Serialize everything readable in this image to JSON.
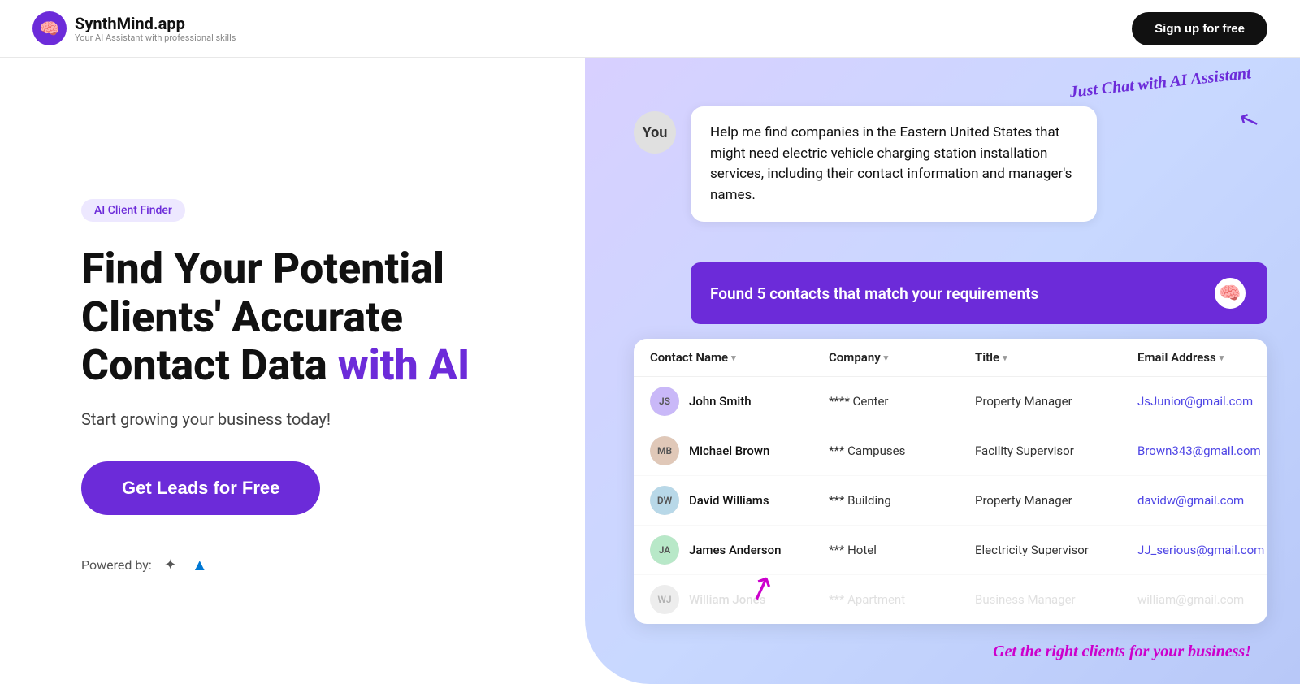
{
  "header": {
    "logo_title": "SynthMind.app",
    "logo_subtitle": "Your AI Assistant with professional skills",
    "logo_icon": "🧠",
    "signup_label": "Sign up for free"
  },
  "hero": {
    "badge": "AI Client Finder",
    "title_line1": "Find Your Potential",
    "title_line2": "Clients' Accurate",
    "title_line3_normal": "Contact Data ",
    "title_line3_highlight": "with AI",
    "subtitle": "Start growing your business today!",
    "cta_label": "Get Leads for Free",
    "powered_by_label": "Powered by:"
  },
  "chat": {
    "just_chat_label": "Just Chat with AI Assistant",
    "you_label": "You",
    "message": "Help me find companies in the Eastern United States that might need electric vehicle charging station installation services, including their contact information and manager's names.",
    "found_label": "Found 5 contacts that match your requirements",
    "get_clients_label": "Get the right clients for your business!"
  },
  "table": {
    "columns": [
      "Contact Name",
      "Company",
      "Title",
      "Email Address"
    ],
    "rows": [
      {
        "name": "John Smith",
        "company": "**** Center",
        "title": "Property Manager",
        "email": "JsJunior@gmail.com"
      },
      {
        "name": "Michael Brown",
        "company": "*** Campuses",
        "title": "Facility Supervisor",
        "email": "Brown343@gmail.com"
      },
      {
        "name": "David Williams",
        "company": "*** Building",
        "title": "Property Manager",
        "email": "davidw@gmail.com"
      },
      {
        "name": "James Anderson",
        "company": "*** Hotel",
        "title": "Electricity Supervisor",
        "email": "JJ_serious@gmail.com"
      },
      {
        "name": "William Jones",
        "company": "*** Apartment",
        "title": "Business Manager",
        "email": "william@gmail.com",
        "blurred": true
      }
    ]
  }
}
